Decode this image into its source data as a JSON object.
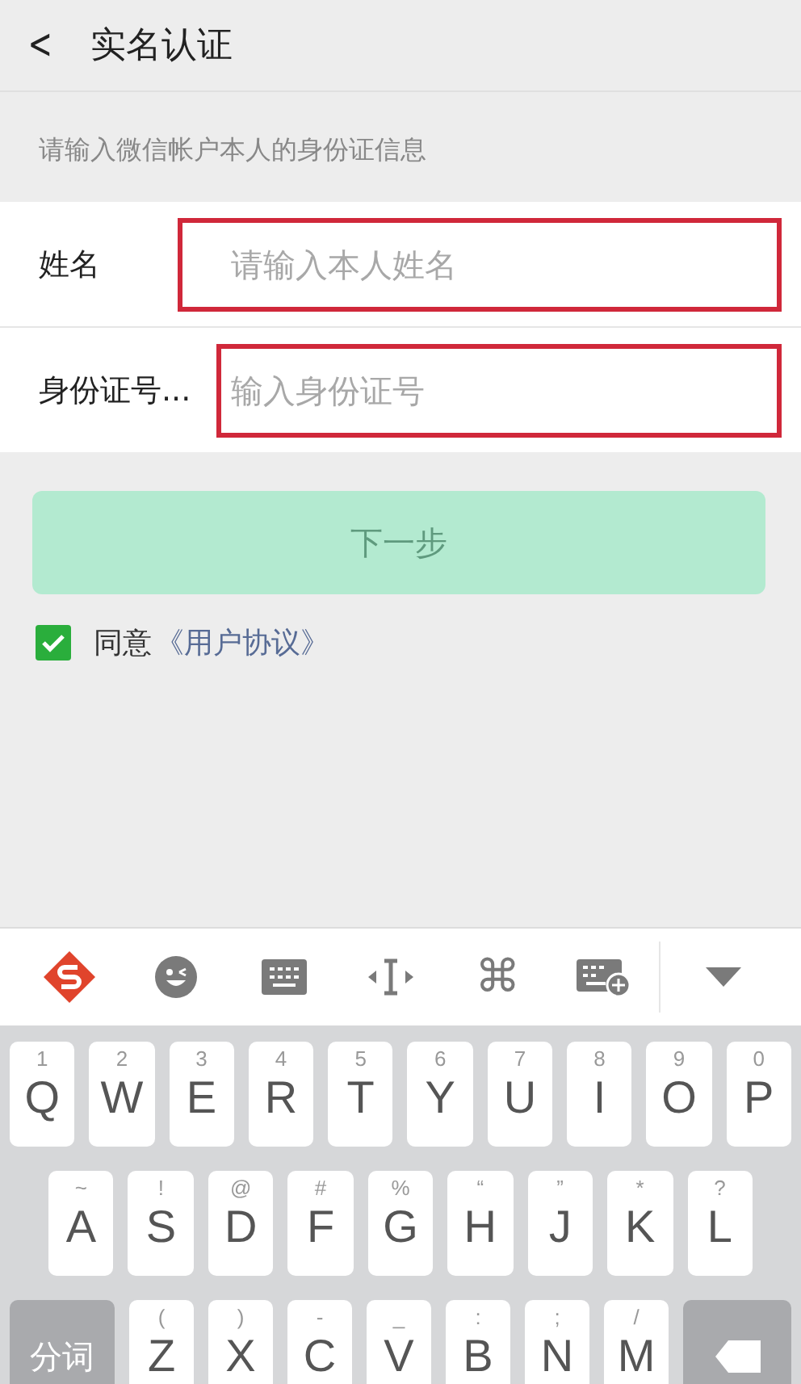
{
  "header": {
    "back": "<",
    "title": "实名认证"
  },
  "hint": "请输入微信帐户本人的身份证信息",
  "fields": [
    {
      "label": "姓名",
      "placeholder": "请输入本人姓名",
      "highlighted": true
    },
    {
      "label": "身份证号...",
      "placeholder": "输入身份证号",
      "highlighted": true
    }
  ],
  "next_button": {
    "label": "下一步",
    "disabled": true
  },
  "agreement": {
    "checked": true,
    "text": "同意",
    "link": "《用户协议》"
  },
  "toolbar": [
    {
      "kind": "logo"
    },
    {
      "kind": "emoji"
    },
    {
      "kind": "keyboard"
    },
    {
      "kind": "cursor"
    },
    {
      "kind": "glyph",
      "text": "⌘"
    },
    {
      "kind": "keyboard-add"
    },
    {
      "kind": "collapse"
    }
  ],
  "keyboard": {
    "rows": [
      {
        "keys": [
          {
            "kind": "letter",
            "hint": "1",
            "label": "Q"
          },
          {
            "kind": "letter",
            "hint": "2",
            "label": "W"
          },
          {
            "kind": "letter",
            "hint": "3",
            "label": "E"
          },
          {
            "kind": "letter",
            "hint": "4",
            "label": "R"
          },
          {
            "kind": "letter",
            "hint": "5",
            "label": "T"
          },
          {
            "kind": "letter",
            "hint": "6",
            "label": "Y"
          },
          {
            "kind": "letter",
            "hint": "7",
            "label": "U"
          },
          {
            "kind": "letter",
            "hint": "8",
            "label": "I"
          },
          {
            "kind": "letter",
            "hint": "9",
            "label": "O"
          },
          {
            "kind": "letter",
            "hint": "0",
            "label": "P"
          }
        ]
      },
      {
        "keys": [
          {
            "kind": "letter",
            "hint": "~",
            "label": "A"
          },
          {
            "kind": "letter",
            "hint": "!",
            "label": "S"
          },
          {
            "kind": "letter",
            "hint": "@",
            "label": "D"
          },
          {
            "kind": "letter",
            "hint": "#",
            "label": "F"
          },
          {
            "kind": "letter",
            "hint": "%",
            "label": "G"
          },
          {
            "kind": "letter",
            "hint": "“",
            "label": "H"
          },
          {
            "kind": "letter",
            "hint": "”",
            "label": "J"
          },
          {
            "kind": "letter",
            "hint": "*",
            "label": "K"
          },
          {
            "kind": "letter",
            "hint": "?",
            "label": "L"
          }
        ]
      },
      {
        "keys": [
          {
            "kind": "function",
            "label": "分词"
          },
          {
            "kind": "letter",
            "hint": "(",
            "label": "Z"
          },
          {
            "kind": "letter",
            "hint": ")",
            "label": "X"
          },
          {
            "kind": "letter",
            "hint": "-",
            "label": "C"
          },
          {
            "kind": "letter",
            "hint": "_",
            "label": "V"
          },
          {
            "kind": "letter",
            "hint": ":",
            "label": "B"
          },
          {
            "kind": "letter",
            "hint": ";",
            "label": "N"
          },
          {
            "kind": "letter",
            "hint": "/",
            "label": "M"
          },
          {
            "kind": "delete"
          }
        ]
      }
    ]
  }
}
